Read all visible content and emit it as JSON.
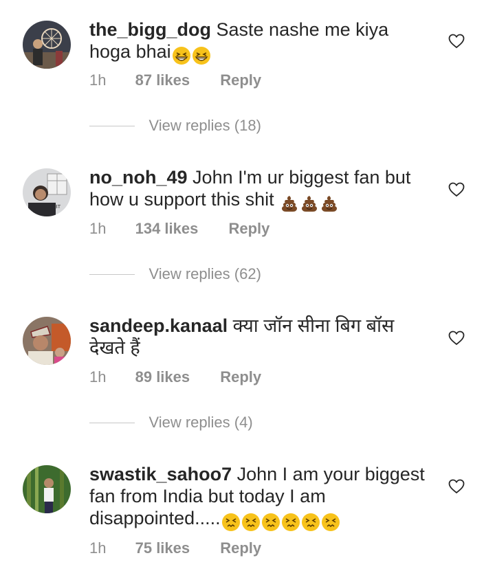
{
  "comments": [
    {
      "username": "the_bigg_dog",
      "text": "Saste nashe me kiya hoga bhai",
      "emoji": [
        "grinning-squint-face",
        "grinning-squint-face"
      ],
      "time": "1h",
      "likes": "87 likes",
      "reply": "Reply",
      "view_replies": "View replies (18)"
    },
    {
      "username": "no_noh_49",
      "text": "John I'm ur biggest fan but how u support this shit",
      "emoji": [
        "pile-of-poo",
        "pile-of-poo",
        "pile-of-poo"
      ],
      "time": "1h",
      "likes": "134 likes",
      "reply": "Reply",
      "view_replies": "View replies (62)"
    },
    {
      "username": "sandeep.kanaal",
      "text": "क्या जॉन सीना बिग बॉस देखते हैं",
      "emoji": [],
      "time": "1h",
      "likes": "89 likes",
      "reply": "Reply",
      "view_replies": "View replies (4)"
    },
    {
      "username": "swastik_sahoo7",
      "text": "John I am your biggest fan from India but today I am disappointed.....",
      "emoji": [
        "persevering-face",
        "persevering-face",
        "persevering-face",
        "persevering-face",
        "persevering-face",
        "persevering-face"
      ],
      "time": "1h",
      "likes": "75 likes",
      "reply": "Reply"
    }
  ],
  "colors": {
    "text": "#262626",
    "meta": "#8e8e8e",
    "divider": "#c7c7c7",
    "emoji_yellow": "#f7c21b",
    "poo_brown": "#7a4a26"
  }
}
